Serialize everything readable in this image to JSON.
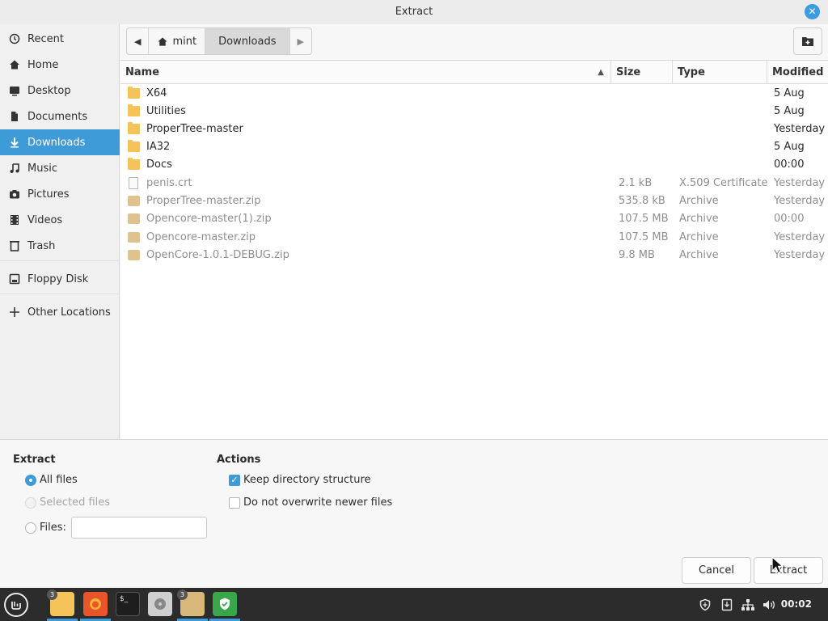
{
  "window": {
    "title": "Extract"
  },
  "sidebar": {
    "items": [
      {
        "label": "Recent",
        "icon": "clock-icon",
        "active": false
      },
      {
        "label": "Home",
        "icon": "home-icon",
        "active": false
      },
      {
        "label": "Desktop",
        "icon": "desktop-icon",
        "active": false
      },
      {
        "label": "Documents",
        "icon": "documents-icon",
        "active": false
      },
      {
        "label": "Downloads",
        "icon": "download-icon",
        "active": true
      },
      {
        "label": "Music",
        "icon": "music-icon",
        "active": false
      },
      {
        "label": "Pictures",
        "icon": "camera-icon",
        "active": false
      },
      {
        "label": "Videos",
        "icon": "film-icon",
        "active": false
      },
      {
        "label": "Trash",
        "icon": "trash-icon",
        "active": false
      },
      {
        "label": "Floppy Disk",
        "icon": "floppy-icon",
        "active": false
      },
      {
        "label": "Other Locations",
        "icon": "plus-icon",
        "active": false
      }
    ]
  },
  "pathbar": {
    "home_crumb": "mint",
    "current_crumb": "Downloads"
  },
  "filelist": {
    "columns": {
      "name": "Name",
      "size": "Size",
      "type": "Type",
      "modified": "Modified"
    },
    "rows": [
      {
        "name": "X64",
        "size": "",
        "type": "",
        "modified": "5 Aug",
        "kind": "folder"
      },
      {
        "name": "Utilities",
        "size": "",
        "type": "",
        "modified": "5 Aug",
        "kind": "folder"
      },
      {
        "name": "ProperTree-master",
        "size": "",
        "type": "",
        "modified": "Yesterday",
        "kind": "folder"
      },
      {
        "name": "IA32",
        "size": "",
        "type": "",
        "modified": "5 Aug",
        "kind": "folder"
      },
      {
        "name": "Docs",
        "size": "",
        "type": "",
        "modified": "00:00",
        "kind": "folder"
      },
      {
        "name": "penis.crt",
        "size": "2.1 kB",
        "type": "X.509 Certificate",
        "modified": "Yesterday",
        "kind": "doc"
      },
      {
        "name": "ProperTree-master.zip",
        "size": "535.8 kB",
        "type": "Archive",
        "modified": "Yesterday",
        "kind": "archive"
      },
      {
        "name": "Opencore-master(1).zip",
        "size": "107.5 MB",
        "type": "Archive",
        "modified": "00:00",
        "kind": "archive"
      },
      {
        "name": "Opencore-master.zip",
        "size": "107.5 MB",
        "type": "Archive",
        "modified": "Yesterday",
        "kind": "archive"
      },
      {
        "name": "OpenCore-1.0.1-DEBUG.zip",
        "size": "9.8 MB",
        "type": "Archive",
        "modified": "Yesterday",
        "kind": "archive"
      }
    ]
  },
  "options": {
    "extract_title": "Extract",
    "all_files": "All files",
    "selected_files": "Selected files",
    "files_label": "Files:",
    "files_value": "",
    "actions_title": "Actions",
    "keep_structure": "Keep directory structure",
    "no_overwrite": "Do not overwrite newer files"
  },
  "buttons": {
    "cancel": "Cancel",
    "extract": "Extract"
  },
  "taskbar": {
    "file_manager_badge": "3",
    "archive_badge": "3",
    "terminal_glyph": "$_",
    "clock": "00:02"
  },
  "colors": {
    "accent": "#3f9ad8",
    "folder": "#f4c35a",
    "taskbar": "#2c2c2c"
  }
}
